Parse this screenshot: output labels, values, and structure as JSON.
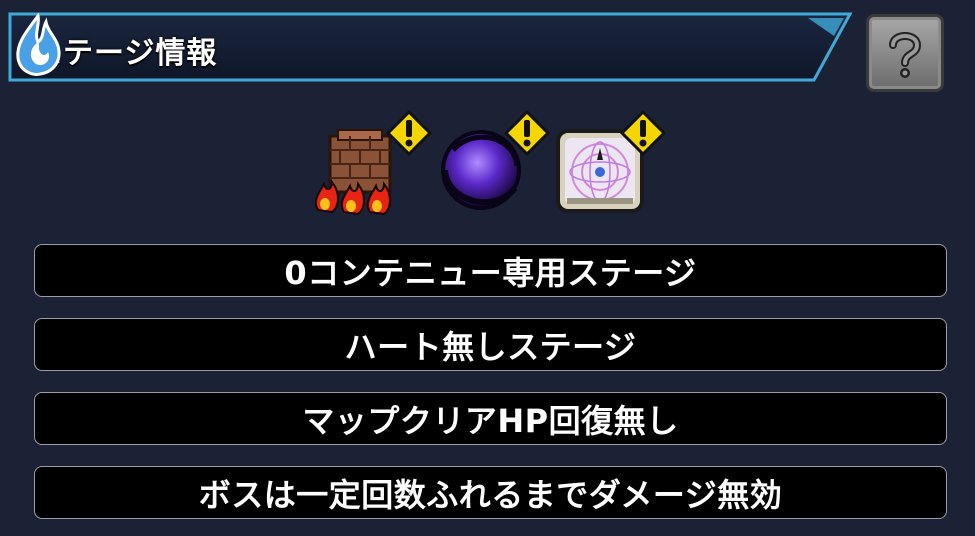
{
  "header": {
    "title": "ステージ情報"
  },
  "icons": {
    "attribute": "water-flame-icon",
    "help": "help-question-icon",
    "gimmicks": [
      "wall-fire-gimmick-icon",
      "black-hole-gimmick-icon",
      "magic-circle-gimmick-icon"
    ],
    "warning": "warning-exclamation-icon"
  },
  "colors": {
    "header_border": "#3fa9d8",
    "water_blue": "#4aa0e6",
    "warning_yellow": "#f5d600",
    "row_border": "#9a9ca6"
  },
  "stage_info": [
    "0コンテニュー専用ステージ",
    "ハート無しステージ",
    "マップクリアHP回復無し",
    "ボスは一定回数ふれるまでダメージ無効"
  ]
}
